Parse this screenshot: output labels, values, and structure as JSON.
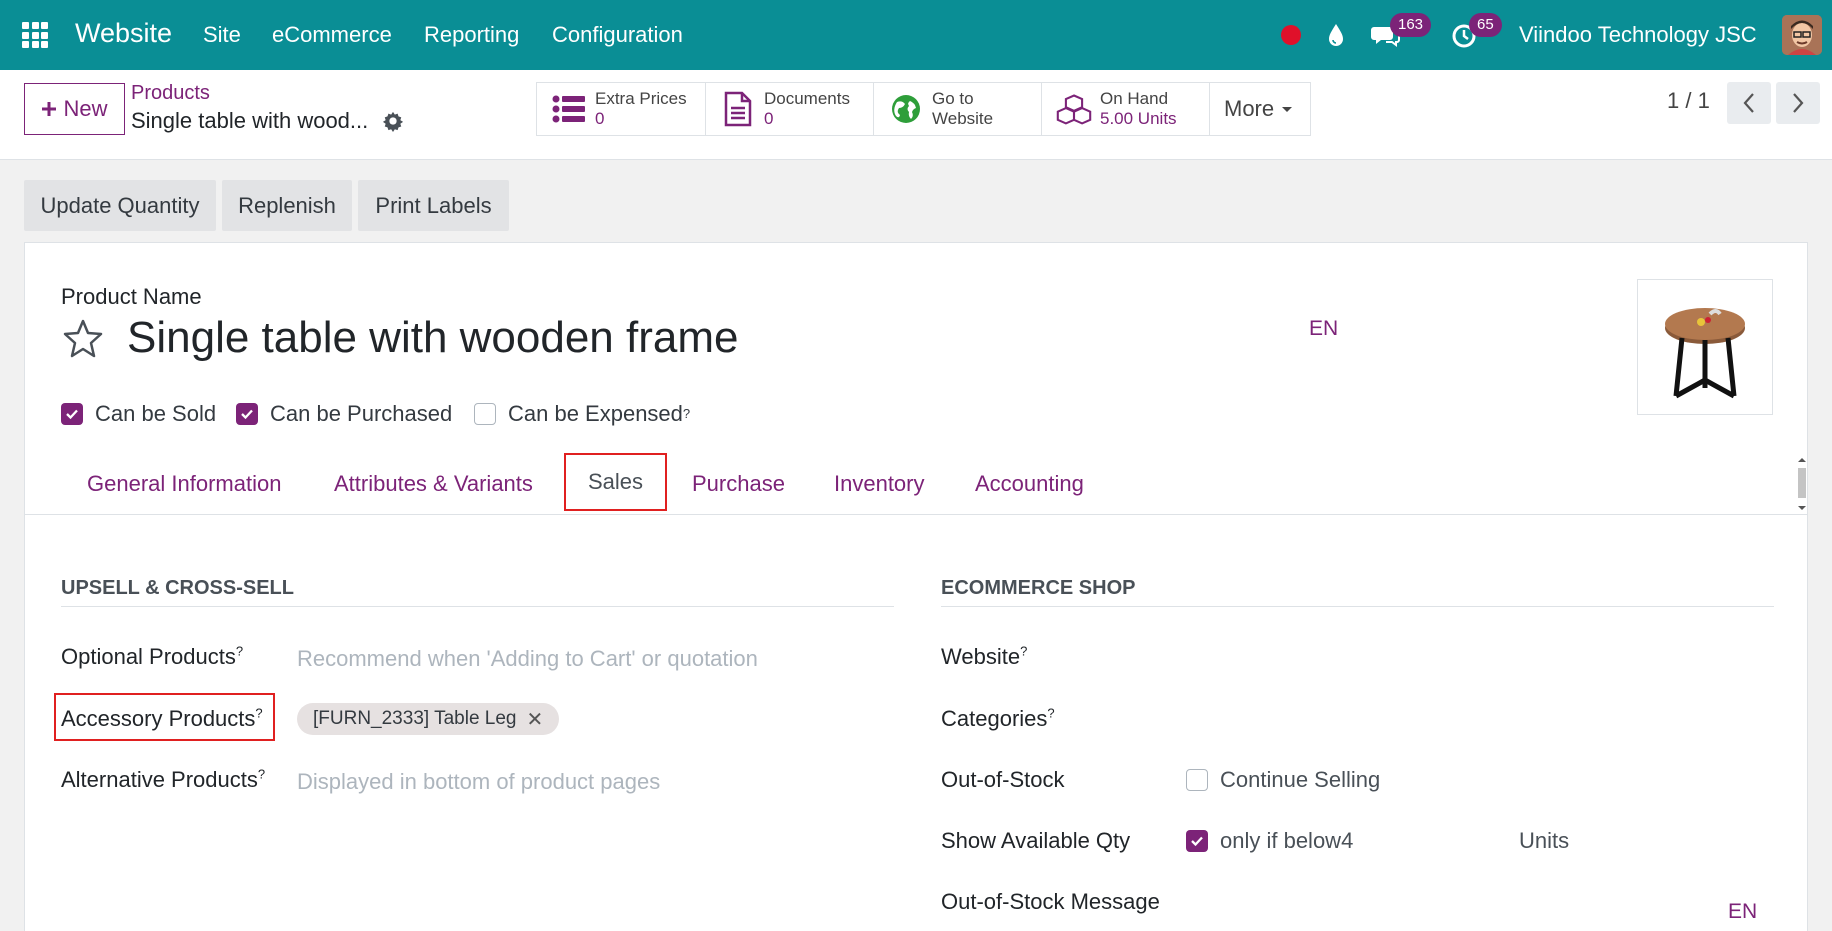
{
  "navbar": {
    "app_name": "Website",
    "menus": [
      "Site",
      "eCommerce",
      "Reporting",
      "Configuration"
    ],
    "messages_badge": "163",
    "activities_badge": "65",
    "company": "Viindoo Technology JSC"
  },
  "control_panel": {
    "new_label": "New",
    "breadcrumb_parent": "Products",
    "breadcrumb_current": "Single table with wood...",
    "smart_buttons": {
      "extra_prices": {
        "label": "Extra Prices",
        "value": "0"
      },
      "documents": {
        "label": "Documents",
        "value": "0"
      },
      "go_to_website": {
        "line1": "Go to",
        "line2": "Website"
      },
      "on_hand": {
        "label": "On Hand",
        "value": "5.00 Units"
      },
      "more": "More"
    },
    "pager": "1 / 1"
  },
  "actions": [
    "Update Quantity",
    "Replenish",
    "Print Labels"
  ],
  "form": {
    "product_name_label": "Product Name",
    "product_name": "Single table with wooden frame",
    "lang": "EN",
    "checkboxes": {
      "can_be_sold": {
        "label": "Can be Sold",
        "checked": true
      },
      "can_be_purchased": {
        "label": "Can be Purchased",
        "checked": true
      },
      "can_be_expensed": {
        "label": "Can be Expensed",
        "checked": false
      }
    },
    "tabs": [
      "General Information",
      "Attributes & Variants",
      "Sales",
      "Purchase",
      "Inventory",
      "Accounting"
    ],
    "active_tab": "Sales",
    "upsell": {
      "title": "UPSELL & CROSS-SELL",
      "optional_label": "Optional Products",
      "optional_placeholder": "Recommend when 'Adding to Cart' or quotation",
      "accessory_label": "Accessory Products",
      "accessory_tag": "[FURN_2333] Table Leg",
      "alternative_label": "Alternative Products",
      "alternative_placeholder": "Displayed in bottom of product pages"
    },
    "ecommerce": {
      "title": "ECOMMERCE SHOP",
      "website_label": "Website",
      "categories_label": "Categories",
      "out_of_stock_label": "Out-of-Stock",
      "continue_selling": "Continue Selling",
      "continue_selling_checked": false,
      "show_qty_label": "Show Available Qty",
      "show_qty_text": "only if below4",
      "show_qty_checked": true,
      "units": "Units",
      "oos_message_label": "Out-of-Stock Message",
      "lang": "EN"
    }
  },
  "colors": {
    "navbar": "#0a8e95",
    "accent": "#7c2378",
    "highlight": "#e02020"
  }
}
